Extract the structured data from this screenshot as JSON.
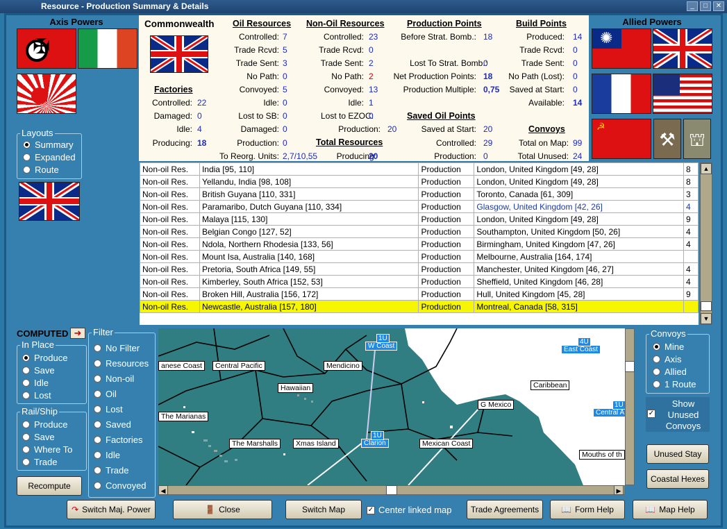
{
  "window": {
    "title": "Resource - Production Summary & Details"
  },
  "axis": {
    "title": "Axis Powers"
  },
  "allied": {
    "title": "Allied Powers"
  },
  "layouts": {
    "title": "Layouts",
    "options": [
      "Summary",
      "Expanded",
      "Route"
    ],
    "selected": "Summary"
  },
  "stats": {
    "country": "Commonwealth",
    "factories": {
      "heading": "Factories",
      "rows": [
        {
          "label": "Controlled:",
          "value": "22"
        },
        {
          "label": "Damaged:",
          "value": "0"
        },
        {
          "label": "Idle:",
          "value": "4"
        },
        {
          "label": "Producing:",
          "value": "18"
        }
      ]
    },
    "oil": {
      "heading": "Oil Resources",
      "rows": [
        {
          "label": "Controlled:",
          "value": "7"
        },
        {
          "label": "Trade Rcvd:",
          "value": "5"
        },
        {
          "label": "Trade Sent:",
          "value": "3"
        },
        {
          "label": "No Path:",
          "value": "0"
        },
        {
          "label": "Convoyed:",
          "value": "5"
        },
        {
          "label": "Idle:",
          "value": "0"
        },
        {
          "label": "Lost to SB:",
          "value": "0"
        },
        {
          "label": "Damaged:",
          "value": "0"
        },
        {
          "label": "Production:",
          "value": "0"
        },
        {
          "label": "To Reorg. Units:",
          "value": "2,7/10,55"
        }
      ]
    },
    "nonoil": {
      "heading": "Non-Oil Resources",
      "rows": [
        {
          "label": "Controlled:",
          "value": "23"
        },
        {
          "label": "Trade Rcvd:",
          "value": "0"
        },
        {
          "label": "Trade Sent:",
          "value": "2"
        },
        {
          "label": "No Path:",
          "value": "2"
        },
        {
          "label": "Convoyed:",
          "value": "13"
        },
        {
          "label": "Idle:",
          "value": "1"
        },
        {
          "label": "Lost to EZOC:",
          "value": "0"
        },
        {
          "label": "Production:",
          "value": "20"
        }
      ]
    },
    "total": {
      "heading": "Total Resources",
      "label": "Producing:",
      "value": "20"
    },
    "prod": {
      "heading": "Production Points",
      "rows": [
        {
          "label": "Before Strat. Bomb.:",
          "value": "18"
        },
        {
          "label": "Lost To Strat. Bomb.:",
          "value": "0"
        },
        {
          "label": "Net Production Points:",
          "value": "18"
        },
        {
          "label": "Production Multiple:",
          "value": "0,75"
        }
      ]
    },
    "savedoil": {
      "heading": "Saved Oil Points",
      "rows": [
        {
          "label": "Saved at Start:",
          "value": "20"
        },
        {
          "label": "Controlled:",
          "value": "29"
        },
        {
          "label": "Production:",
          "value": "0"
        }
      ]
    },
    "build": {
      "heading": "Build Points",
      "rows": [
        {
          "label": "Produced:",
          "value": "14"
        },
        {
          "label": "Trade Rcvd:",
          "value": "0"
        },
        {
          "label": "Trade Sent:",
          "value": "0"
        },
        {
          "label": "No Path (Lost):",
          "value": "0"
        },
        {
          "label": "Saved at Start:",
          "value": "0"
        },
        {
          "label": "Available:",
          "value": "14"
        }
      ]
    },
    "convoys": {
      "heading": "Convoys",
      "rows": [
        {
          "label": "Total on Map:",
          "value": "99"
        },
        {
          "label": "Total Unused:",
          "value": "24"
        }
      ]
    }
  },
  "table": {
    "rows": [
      {
        "type": "Non-oil Res.",
        "location": "India [95, 110]",
        "use": "Production",
        "dest": "London, United Kingdom [49, 28]",
        "n": "8"
      },
      {
        "type": "Non-oil Res.",
        "location": "Yellandu, India [98, 108]",
        "use": "Production",
        "dest": "London, United Kingdom [49, 28]",
        "n": "8"
      },
      {
        "type": "Non-oil Res.",
        "location": "British Guyana [110, 331]",
        "use": "Production",
        "dest": "Toronto, Canada [61, 309]",
        "n": "3"
      },
      {
        "type": "Non-oil Res.",
        "location": "Paramaribo, Dutch Guyana [110, 334]",
        "use": "Production",
        "dest": "Glasgow, United Kingdom [42, 26]",
        "n": "4"
      },
      {
        "type": "Non-oil Res.",
        "location": "Malaya [115, 130]",
        "use": "Production",
        "dest": "London, United Kingdom [49, 28]",
        "n": "9"
      },
      {
        "type": "Non-oil Res.",
        "location": "Belgian Congo [127, 52]",
        "use": "Production",
        "dest": "Southampton, United Kingdom [50, 26]",
        "n": "4"
      },
      {
        "type": "Non-oil Res.",
        "location": "Ndola, Northern Rhodesia [133, 56]",
        "use": "Production",
        "dest": "Birmingham, United Kingdom [47, 26]",
        "n": "4"
      },
      {
        "type": "Non-oil Res.",
        "location": "Mount Isa, Australia [140, 168]",
        "use": "Production",
        "dest": "Melbourne, Australia [164, 174]",
        "n": ""
      },
      {
        "type": "Non-oil Res.",
        "location": "Pretoria, South Africa [149, 55]",
        "use": "Production",
        "dest": "Manchester, United Kingdom [46, 27]",
        "n": "4"
      },
      {
        "type": "Non-oil Res.",
        "location": "Kimberley, South Africa [152, 53]",
        "use": "Production",
        "dest": "Sheffield, United Kingdom [46, 28]",
        "n": "4"
      },
      {
        "type": "Non-oil Res.",
        "location": "Broken Hill, Australia [156, 172]",
        "use": "Production",
        "dest": "Hull, United Kingdom [45, 28]",
        "n": "9"
      },
      {
        "type": "Non-oil Res.",
        "location": "Newcastle, Australia [157, 180]",
        "use": "Production",
        "dest": "Montreal, Canada [58, 315]",
        "n": ""
      }
    ]
  },
  "computed": {
    "label": "COMPUTED"
  },
  "inplace": {
    "title": "In Place",
    "options": [
      "Produce",
      "Save",
      "Idle",
      "Lost"
    ]
  },
  "railship": {
    "title": "Rail/Ship",
    "options": [
      "Produce",
      "Save",
      "Where To",
      "Trade"
    ]
  },
  "filter": {
    "title": "Filter",
    "options": [
      "No Filter",
      "Resources",
      "Non-oil",
      "Oil",
      "Lost",
      "Saved",
      "Factories",
      "Idle",
      "Trade",
      "Convoyed"
    ]
  },
  "convoysPanel": {
    "title": "Convoys",
    "options": [
      "Mine",
      "Axis",
      "Allied",
      "1 Route"
    ],
    "show_unused": "Show Unused Convoys"
  },
  "map": {
    "labels": [
      "anese Coast",
      "Central Pacific",
      "Mendicino",
      "Hawaiian",
      "Caribbean",
      "G Mexico",
      "The Marianas",
      "The Marshalls",
      "Xmas Island",
      "Mexican Coast",
      "Mouths of th"
    ],
    "blue_labels": [
      "W Coast",
      "East Coast",
      "Clarion",
      "Central A"
    ],
    "unit_tags": [
      "1U",
      "4U",
      "1U",
      "1U"
    ]
  },
  "buttons": {
    "recompute": "Recompute",
    "unused_stay": "Unused Stay",
    "coastal_hexes": "Coastal Hexes",
    "switch_major": "Switch Maj. Power",
    "close": "Close",
    "switch_map": "Switch Map",
    "center_linked": "Center linked map",
    "trade": "Trade Agreements",
    "form_help": "Form Help",
    "map_help": "Map Help"
  }
}
